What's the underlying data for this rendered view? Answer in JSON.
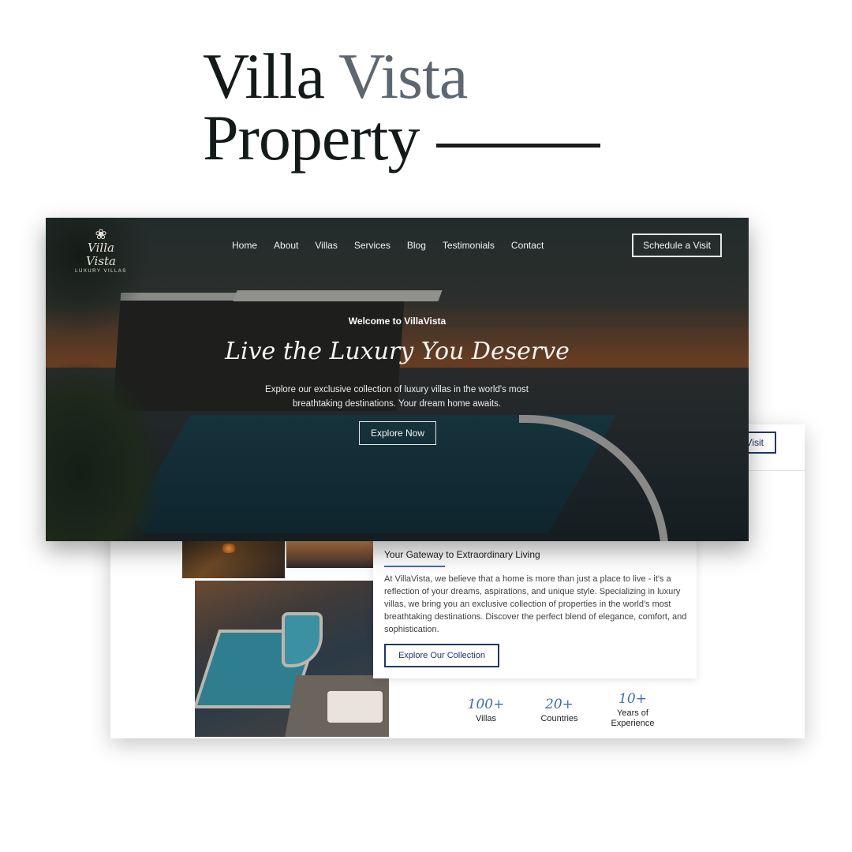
{
  "headline": {
    "line1_dark": "Villa",
    "line1_accent": "Vista",
    "line2": "Property"
  },
  "hero": {
    "logo_icon": "flower-emblem-icon",
    "logo_name": "Villa Vista",
    "logo_tagline": "LUXURY VILLAS",
    "nav": [
      "Home",
      "About",
      "Villas",
      "Services",
      "Blog",
      "Testimonials",
      "Contact"
    ],
    "schedule_label": "Schedule a Visit",
    "welcome": "Welcome to VillaVista",
    "title": "Live the Luxury You Deserve",
    "subtitle": "Explore our exclusive collection of luxury villas in the world's most breathtaking destinations. Your dream home awaits.",
    "explore_label": "Explore Now"
  },
  "about": {
    "visit_label": "Visit",
    "title": "Your Gateway to Extraordinary Living",
    "body": "At VillaVista, we believe that a home is more than just a place to live - it's a reflection of your dreams, aspirations, and unique style. Specializing in luxury villas, we bring you an exclusive collection of properties in the world's most breathtaking destinations. Discover the perfect blend of elegance, comfort, and sophistication.",
    "button_label": "Explore Our Collection",
    "stats": [
      {
        "value": "100+",
        "label": "Villas"
      },
      {
        "value": "20+",
        "label": "Countries"
      },
      {
        "value": "10+",
        "label": "Years of Experience"
      }
    ]
  },
  "colors": {
    "accent_blue": "#3d6cb2",
    "navy_button": "#22356b",
    "headline_dark": "#141a1a",
    "headline_accent": "#5e6670"
  }
}
